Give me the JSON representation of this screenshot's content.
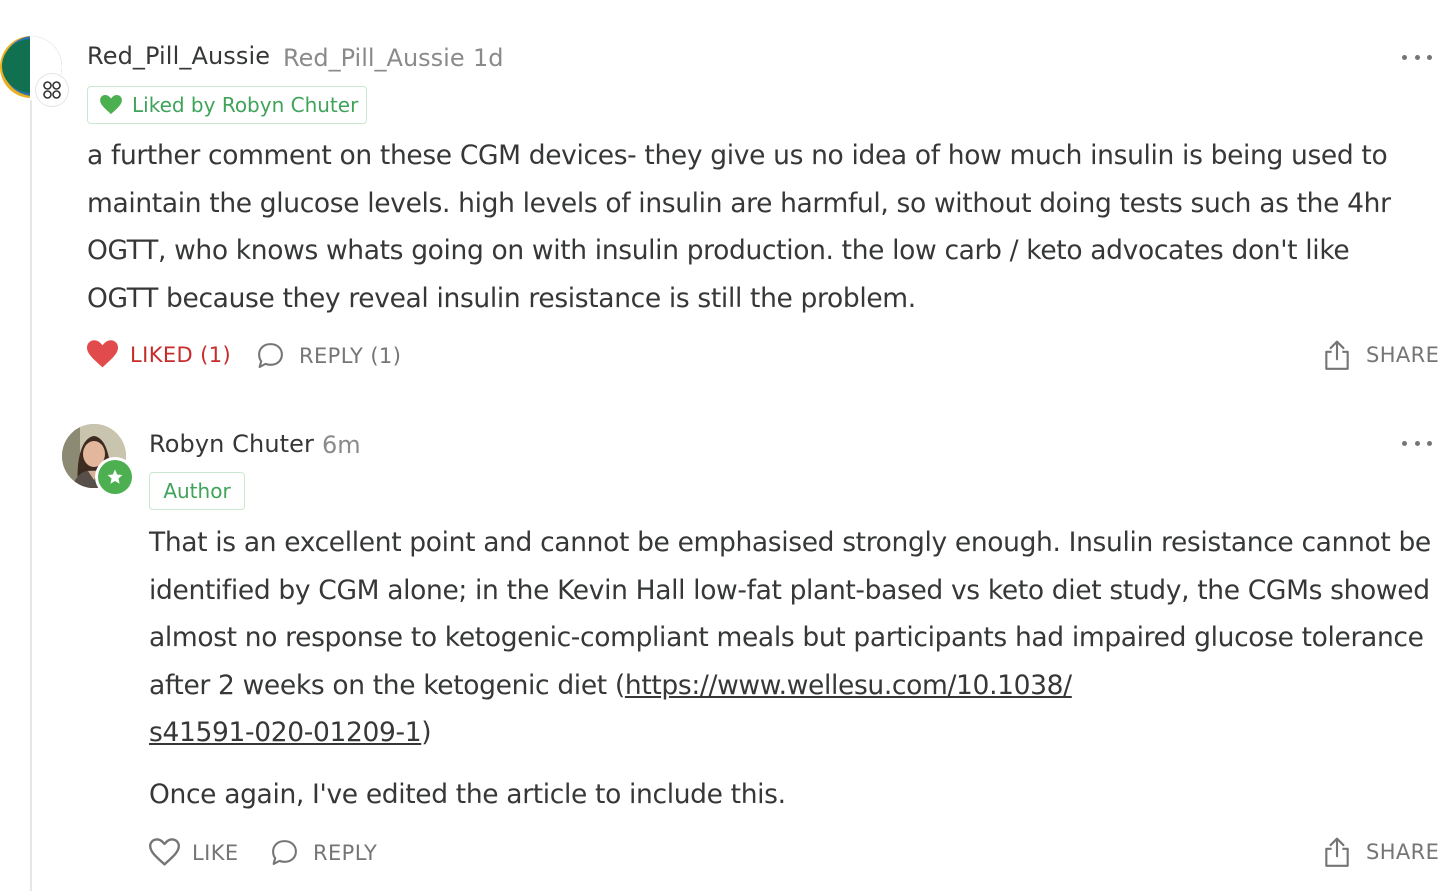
{
  "comment1": {
    "username": "Red_Pill_Aussie",
    "handle": "Red_Pill_Aussie",
    "time": "1d",
    "liked_by": "Liked by Robyn Chuter",
    "body": "a further comment on these CGM devices- they give us no idea of how much insulin is being used to maintain the glucose levels. high levels of insulin are harmful, so without doing tests such as the 4hr OGTT, who knows whats going on with insulin production. the low carb / keto advocates don't like OGTT because they reveal insulin resistance is still the problem.",
    "actions": {
      "like": "LIKED (1)",
      "reply": "REPLY (1)",
      "share": "SHARE"
    }
  },
  "comment2": {
    "username": "Robyn Chuter",
    "time": "6m",
    "role_badge": "Author",
    "paragraph1_text": "That is an excellent point and cannot be emphasised strongly enough. Insulin resistance cannot be identified by CGM alone; in the Kevin Hall low-fat plant-based vs keto diet study, the CGMs showed almost no response to ketogenic-compliant meals but participants had impaired glucose tolerance after 2 weeks on the ketogenic diet (",
    "paragraph1_link_line1": "https://www.wellesu.com/10.1038/",
    "paragraph1_link_line2": "s41591-020-01209-1",
    "paragraph1_close": ")",
    "paragraph2": "Once again, I've edited the article to include this.",
    "actions": {
      "like": "LIKE",
      "reply": "REPLY",
      "share": "SHARE"
    }
  },
  "colors": {
    "liked_red": "#c72c2c",
    "heart_fill": "#e14b4b",
    "tag_green": "#3fa35a",
    "author_badge_green": "#4caf50",
    "muted_text": "#757575"
  },
  "icons": {
    "more": "ellipsis-icon",
    "heart": "heart-icon",
    "reply": "speech-bubble-icon",
    "share": "share-upload-icon",
    "author_badge": "star-icon",
    "user_badge": "clover-icon"
  }
}
